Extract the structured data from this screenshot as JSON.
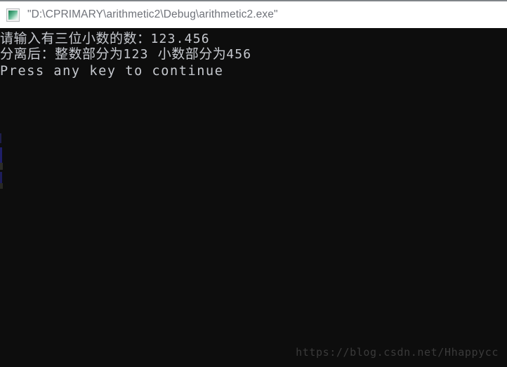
{
  "window": {
    "title": "\"D:\\CPRIMARY\\arithmetic2\\Debug\\arithmetic2.exe\"",
    "icon": "console-window-icon",
    "background_color": "#0d0d0d",
    "titlebar_background_color": "#ffffff",
    "titlebar_text_color": "#70737a",
    "console_text_color": "#c6c9cf"
  },
  "console": {
    "lines": [
      {
        "name": "prompt-line",
        "label": "请输入有三位小数的数：",
        "value": "123.456"
      },
      {
        "name": "result-line",
        "label": "分离后：整数部分为",
        "integer_part": "123",
        "separator": "  小数部分为",
        "fraction_part": "456"
      },
      {
        "name": "press-any-key-line",
        "text": "Press any key to continue"
      }
    ]
  },
  "watermark": {
    "text": "https://blog.csdn.net/Hhappycc",
    "color": "#3a3a3a"
  }
}
